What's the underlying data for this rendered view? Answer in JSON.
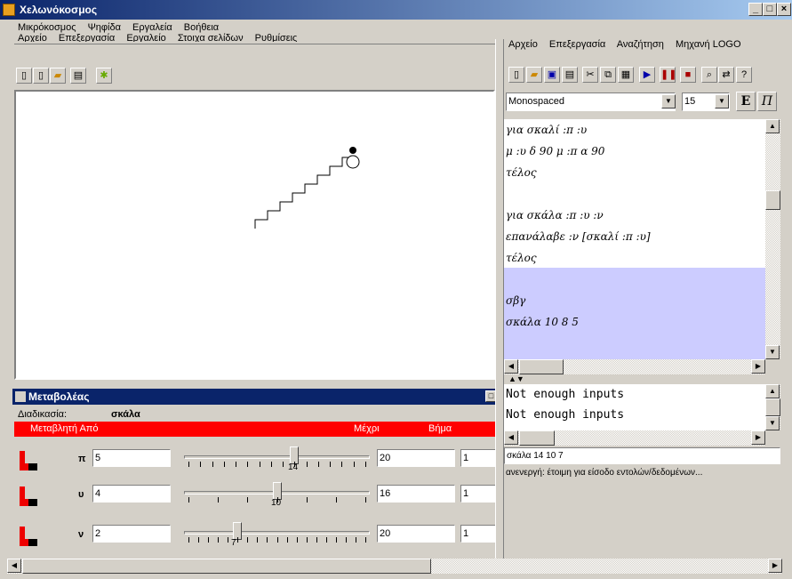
{
  "window": {
    "title": "Χελωνόκοσμος"
  },
  "menubar": [
    "Μικρόκοσμος",
    "Ψηφίδα",
    "Εργαλεία",
    "Βοήθεια"
  ],
  "left_hidden_menu": [
    "Αρχείο",
    "Επεξεργασία",
    "Εργαλείο",
    "Στοιχα σελίδων",
    "Ρυθμίσεις"
  ],
  "right_menu": [
    "Αρχείο",
    "Επεξεργασία",
    "Αναζήτηση",
    "Μηχανή LOGO"
  ],
  "font_select": {
    "value": "Monospaced"
  },
  "size_select": {
    "value": "15"
  },
  "style_buttons": {
    "bold": "Ε",
    "italic": "Π"
  },
  "editor": {
    "lines": [
      "για σκαλί :π :υ",
      "μ :υ δ 90 μ :π α 90",
      "τέλος",
      "",
      "για σκάλα :π :υ :ν",
      "επανάλαβε :ν [σκαλί :π :υ]",
      "τέλος",
      "",
      "σβγ",
      "σκάλα 10 8 5"
    ],
    "highlight_color": "#ccccff"
  },
  "output": {
    "lines": [
      "Not enough inputs",
      "Not enough inputs"
    ]
  },
  "command_input": {
    "value": "σκάλα 14 10 7"
  },
  "status_text": "ανενεργή: έτοιμη για είσοδο εντολών/δεδομένων...",
  "variators": {
    "title": "Μεταβολέας",
    "procedure_label": "Διαδικασία:",
    "procedure_name": "σκάλα",
    "headers": {
      "variable_from": "Μεταβλητή Από",
      "to": "Μέχρι",
      "step": "Βήμα"
    },
    "header_color": "#ff0000",
    "rows": [
      {
        "name": "π",
        "from": "5",
        "value": 14,
        "value_label": "14",
        "to": "20",
        "step": "1"
      },
      {
        "name": "υ",
        "from": "4",
        "value": 10,
        "value_label": "10",
        "to": "16",
        "step": "1"
      },
      {
        "name": "ν",
        "from": "2",
        "value": 7,
        "value_label": "7",
        "to": "20",
        "step": "1"
      }
    ]
  },
  "icons": {
    "left_toolbar": [
      "new-page-icon",
      "new-icon",
      "open-folder-icon",
      "print-icon",
      "turtle-icon"
    ],
    "right_toolbar": [
      "new-icon",
      "open-folder-icon",
      "save-icon",
      "print-icon",
      "cut-icon",
      "copy-icon",
      "paste-icon",
      "play-icon",
      "pause-icon",
      "stop-icon",
      "find-icon",
      "replace-icon",
      "help-icon"
    ]
  }
}
